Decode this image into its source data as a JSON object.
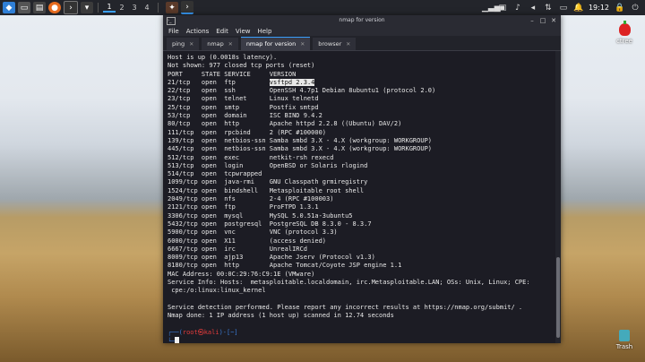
{
  "taskbar": {
    "workspaces": [
      "1",
      "2",
      "3",
      "4"
    ],
    "clock": "19:12",
    "menu_icon": "kali-menu-icon"
  },
  "desktop": {
    "icons": [
      {
        "label": "ctree",
        "icon": "cherrytree-icon"
      },
      {
        "label": "Trash",
        "icon": "trash-icon"
      }
    ]
  },
  "window": {
    "title": "nmap for version",
    "menu": [
      "File",
      "Actions",
      "Edit",
      "View",
      "Help"
    ],
    "tabs": [
      {
        "label": "ping",
        "active": false
      },
      {
        "label": "nmap",
        "active": false
      },
      {
        "label": "nmap for version",
        "active": true
      },
      {
        "label": "browser",
        "active": false
      }
    ]
  },
  "terminal": {
    "lines": [
      "Host is up (0.0018s latency).",
      "Not shown: 977 closed tcp ports (reset)",
      "PORT     STATE SERVICE     VERSION",
      "21/tcp   open  ftp         vsftpd 2.3.4",
      "22/tcp   open  ssh         OpenSSH 4.7p1 Debian 8ubuntu1 (protocol 2.0)",
      "23/tcp   open  telnet      Linux telnetd",
      "25/tcp   open  smtp        Postfix smtpd",
      "53/tcp   open  domain      ISC BIND 9.4.2",
      "80/tcp   open  http        Apache httpd 2.2.8 ((Ubuntu) DAV/2)",
      "111/tcp  open  rpcbind     2 (RPC #100000)",
      "139/tcp  open  netbios-ssn Samba smbd 3.X - 4.X (workgroup: WORKGROUP)",
      "445/tcp  open  netbios-ssn Samba smbd 3.X - 4.X (workgroup: WORKGROUP)",
      "512/tcp  open  exec        netkit-rsh rexecd",
      "513/tcp  open  login       OpenBSD or Solaris rlogind",
      "514/tcp  open  tcpwrapped",
      "1099/tcp open  java-rmi    GNU Classpath grmiregistry",
      "1524/tcp open  bindshell   Metasploitable root shell",
      "2049/tcp open  nfs         2-4 (RPC #100003)",
      "2121/tcp open  ftp         ProFTPD 1.3.1",
      "3306/tcp open  mysql       MySQL 5.0.51a-3ubuntu5",
      "5432/tcp open  postgresql  PostgreSQL DB 8.3.0 - 8.3.7",
      "5900/tcp open  vnc         VNC (protocol 3.3)",
      "6000/tcp open  X11         (access denied)",
      "6667/tcp open  irc         UnrealIRCd",
      "8009/tcp open  ajp13       Apache Jserv (Protocol v1.3)",
      "8180/tcp open  http        Apache Tomcat/Coyote JSP engine 1.1",
      "MAC Address: 00:0C:29:76:C9:1E (VMware)",
      "Service Info: Hosts:  metasploitable.localdomain, irc.Metasploitable.LAN; OSs: Unix, Linux; CPE:",
      " cpe:/o:linux:linux_kernel",
      "",
      "Service detection performed. Please report any incorrect results at https://nmap.org/submit/ .",
      "Nmap done: 1 IP address (1 host up) scanned in 12.74 seconds",
      ""
    ],
    "highlight": "vsftpd 2.3.4",
    "prompt_line1_prefix": "┌──(",
    "prompt_user": "root㉿kali",
    "prompt_line1_suffix": ")-[~]",
    "prompt_line2": "└─"
  }
}
